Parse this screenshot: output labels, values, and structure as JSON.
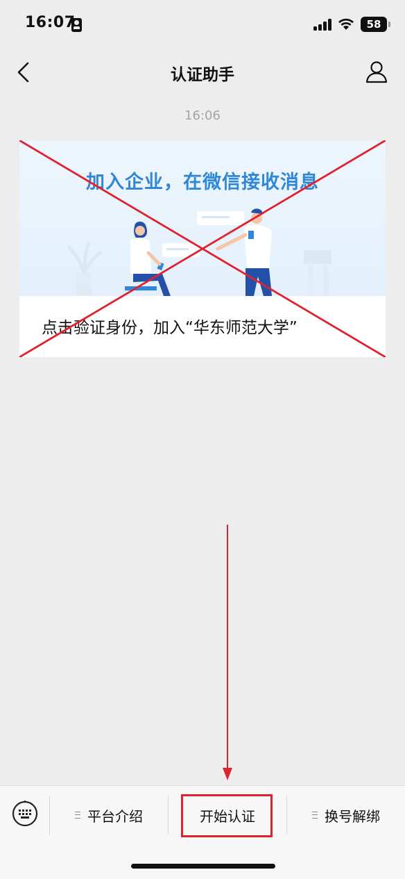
{
  "status_bar": {
    "time": "16:07",
    "battery": "58",
    "icons": [
      "id-card-icon",
      "signal-icon",
      "wifi-icon",
      "battery-icon"
    ]
  },
  "nav": {
    "title": "认证助手",
    "icons": [
      "back-arrow-icon",
      "profile-icon"
    ]
  },
  "chat": {
    "timestamp": "16:06",
    "card": {
      "banner_title": "加入企业，在微信接收消息",
      "caption": "点击验证身份，加入“华东师范大学”",
      "crossed_out": true,
      "cross_color": "#e0212e"
    }
  },
  "annotation": {
    "arrow_color": "#e0212e",
    "highlighted_item": "开始认证"
  },
  "menu": {
    "keyboard_icon": "keyboard-icon",
    "items": [
      {
        "label": "平台介绍",
        "has_submenu": true
      },
      {
        "label": "开始认证",
        "has_submenu": false
      },
      {
        "label": "换号解绑",
        "has_submenu": true
      }
    ]
  },
  "colors": {
    "background": "#ededed",
    "banner_title": "#2f87d8",
    "annotation_red": "#e0212e"
  }
}
